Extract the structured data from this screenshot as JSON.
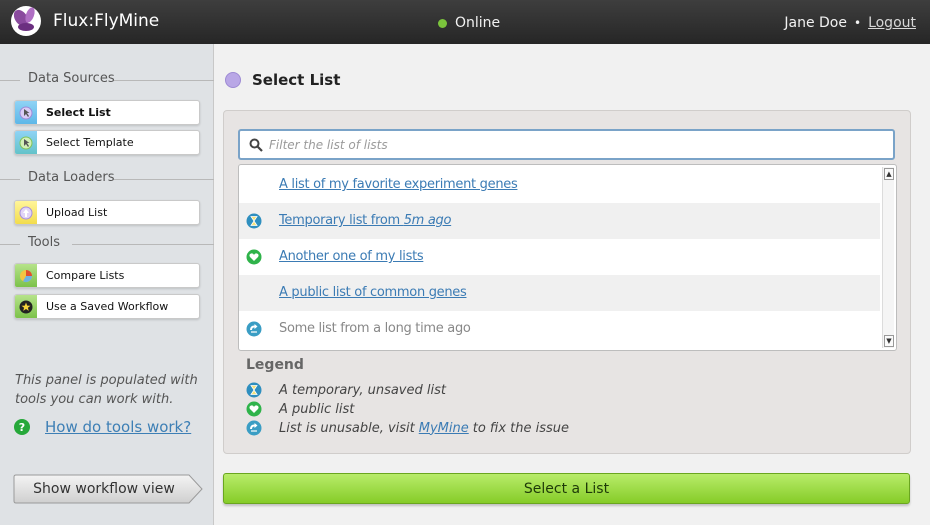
{
  "header": {
    "brand": "Flux:FlyMine",
    "status": "Online",
    "user_name": "Jane Doe",
    "separator": "•",
    "logout_label": "Logout"
  },
  "sidebar": {
    "sections": {
      "data_sources": "Data Sources",
      "data_loaders": "Data Loaders",
      "tools": "Tools"
    },
    "tools": [
      {
        "label": "Select List",
        "icon": "cursor-icon",
        "active": true
      },
      {
        "label": "Select Template",
        "icon": "cursor-icon",
        "active": false
      },
      {
        "label": "Upload List",
        "icon": "upload-icon",
        "active": false
      },
      {
        "label": "Compare Lists",
        "icon": "pie-chart-icon",
        "active": false
      },
      {
        "label": "Use a Saved Workflow",
        "icon": "star-icon",
        "active": false
      }
    ],
    "help_text": "This panel is populated with tools you can work with.",
    "help_link": "How do tools work?",
    "workflow_button": "Show workflow view"
  },
  "main": {
    "title": "Select List",
    "filter_placeholder": "Filter the list of lists",
    "lists": [
      {
        "name": "A list of my favorite experiment genes",
        "status": "normal"
      },
      {
        "name_prefix": "Temporary list from ",
        "name_emphasis": "5m ago",
        "status": "temporary"
      },
      {
        "name": "Another one of my lists",
        "status": "public"
      },
      {
        "name": "A public list of common genes",
        "status": "normal"
      },
      {
        "name": "Some list from a long time ago",
        "status": "unusable"
      }
    ],
    "legend": {
      "title": "Legend",
      "temporary": "A temporary, unsaved list",
      "public": "A public list",
      "unusable_prefix": "List is unusable, visit",
      "unusable_link": "MyMine",
      "unusable_suffix": "to fix the issue"
    },
    "select_button": "Select a List"
  },
  "colors": {
    "accent_green": "#86cc28",
    "link_blue": "#3b7bb4",
    "status_online": "#7bc43c",
    "header_bg": "#2d2d2d"
  }
}
